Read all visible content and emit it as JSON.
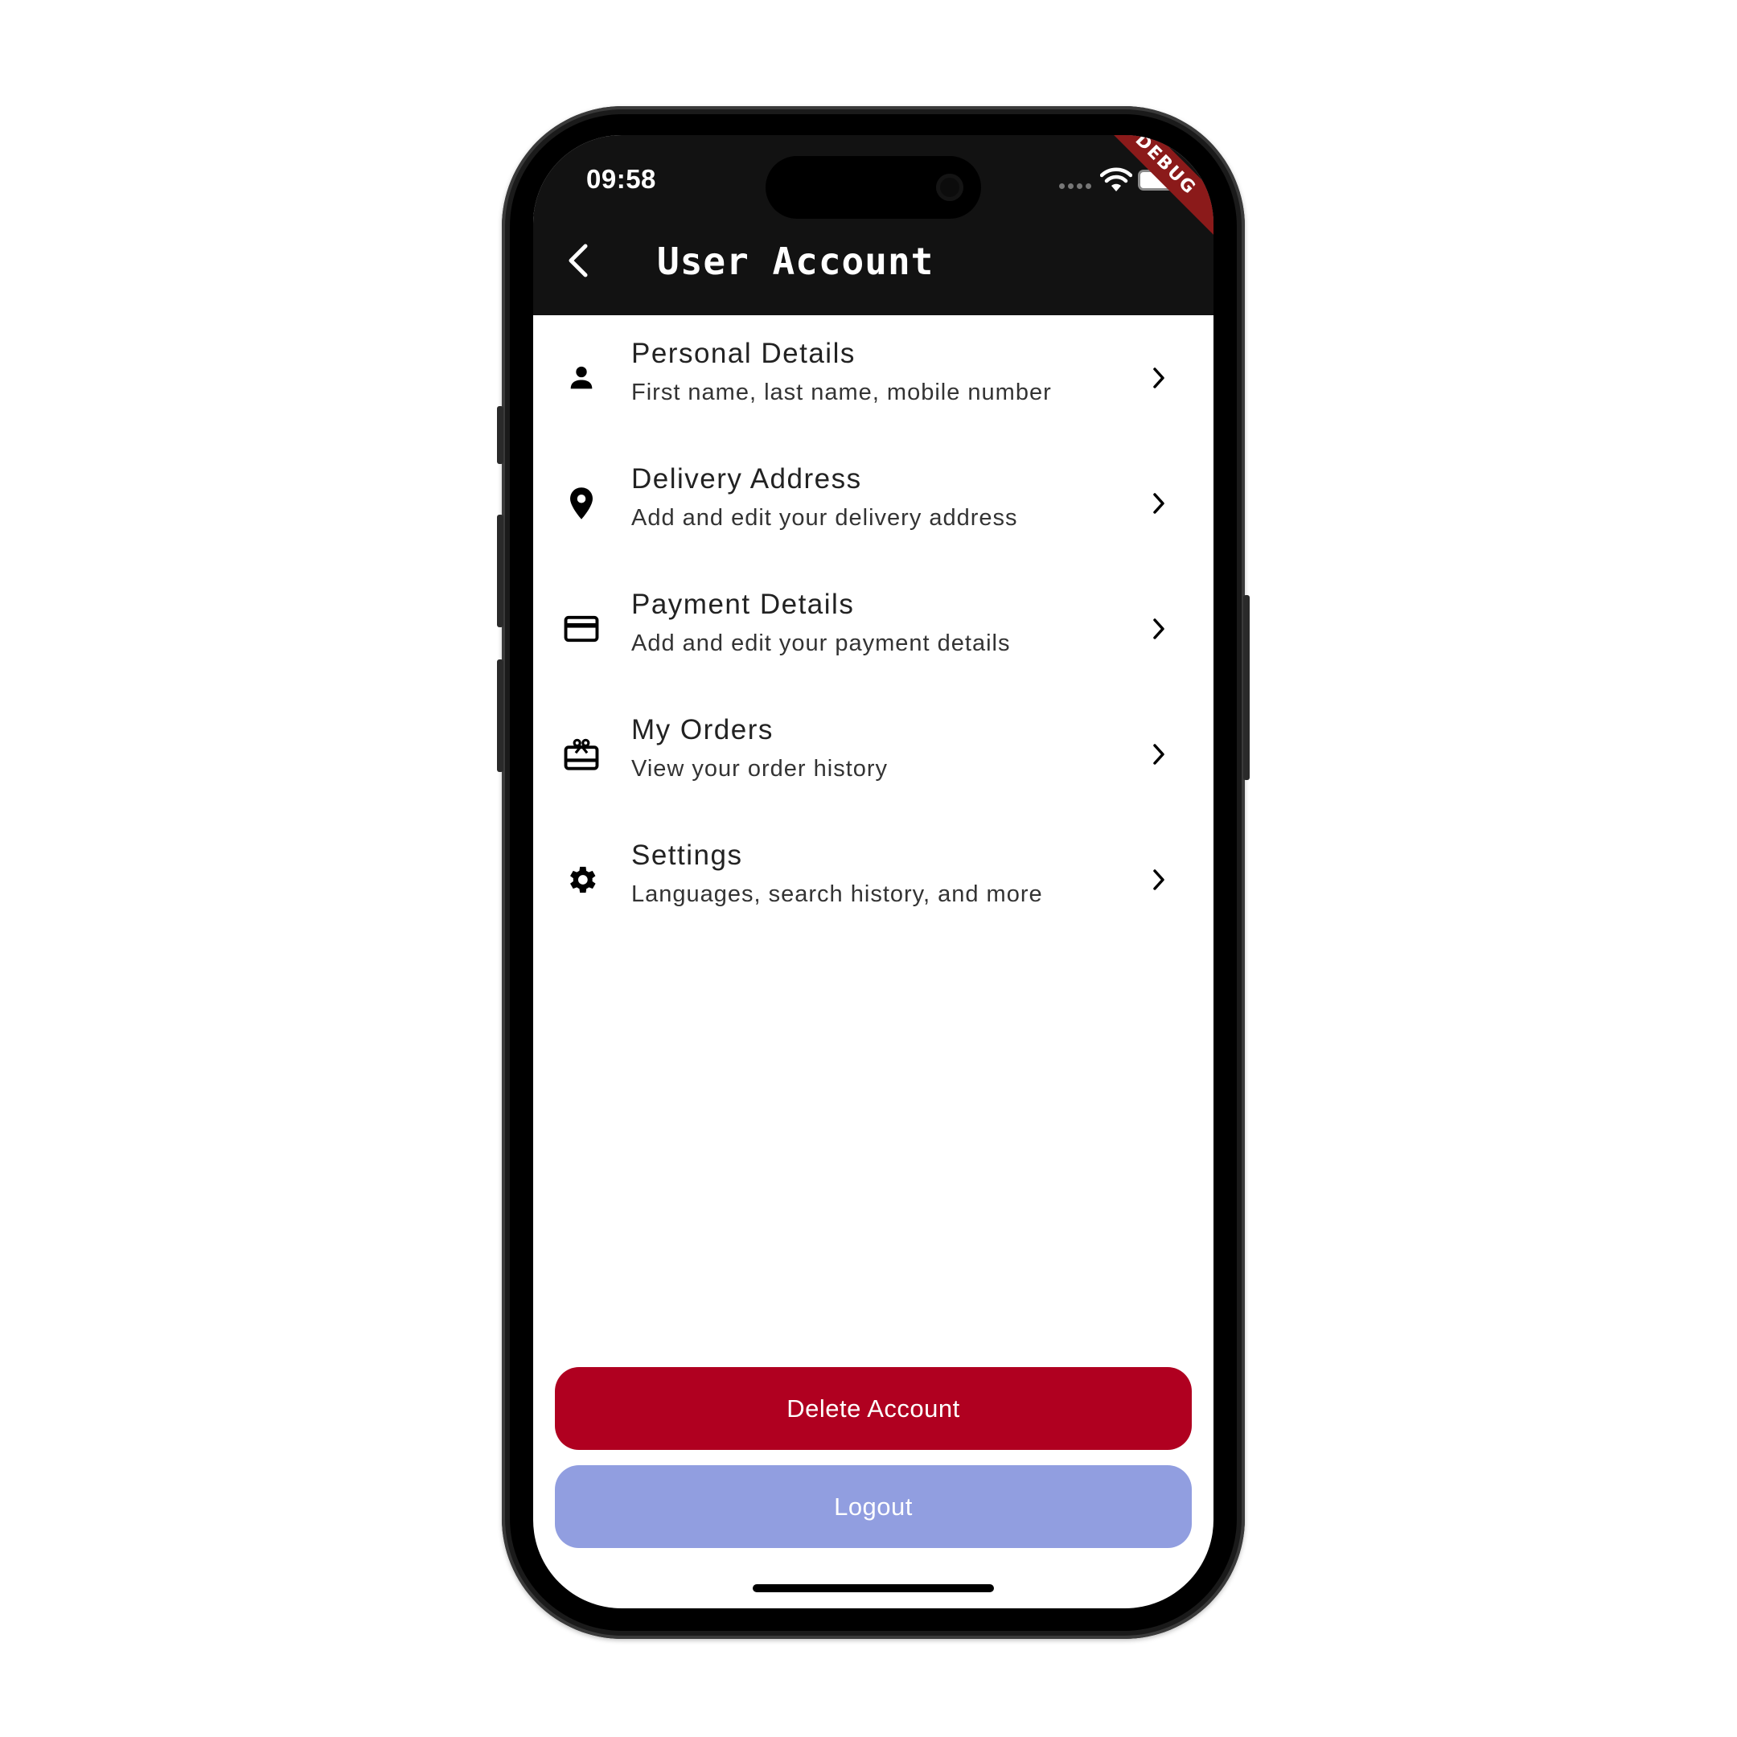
{
  "status_bar": {
    "time": "09:58",
    "debug_banner": "DEBUG"
  },
  "header": {
    "title": "User Account",
    "back_icon": "chevron-left-icon"
  },
  "menu": {
    "items": [
      {
        "icon": "person-icon",
        "title": "Personal Details",
        "subtitle": "First name, last name, mobile number"
      },
      {
        "icon": "location-pin-icon",
        "title": "Delivery Address",
        "subtitle": "Add and edit your delivery address"
      },
      {
        "icon": "credit-card-icon",
        "title": "Payment Details",
        "subtitle": "Add and edit your payment details"
      },
      {
        "icon": "gift-card-icon",
        "title": "My Orders",
        "subtitle": "View your order history"
      },
      {
        "icon": "gear-icon",
        "title": "Settings",
        "subtitle": "Languages, search history, and more"
      }
    ]
  },
  "actions": {
    "delete_label": "Delete Account",
    "logout_label": "Logout"
  },
  "colors": {
    "header_bg": "#121212",
    "delete_bg": "#B00020",
    "logout_bg": "#919EE0",
    "debug_banner": "#8B1A1A"
  }
}
